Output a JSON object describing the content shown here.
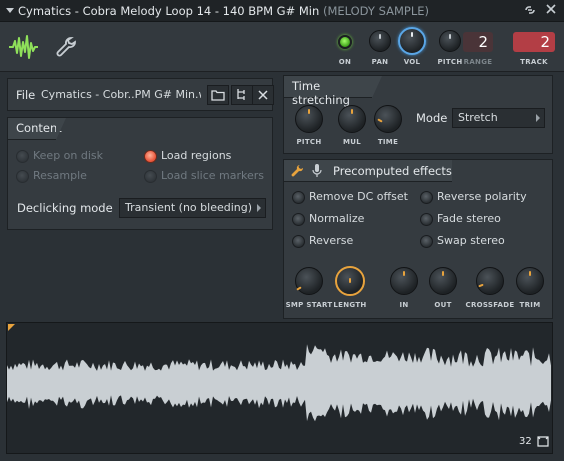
{
  "title": {
    "main": "Cymatics - Cobra Melody Loop 14 - 140 BPM G# Min",
    "sub": "(MELODY SAMPLE)"
  },
  "window": {
    "link_icon": "link-icon",
    "close_icon": "close-icon"
  },
  "toolbar": {
    "tabs": [
      {
        "icon": "waveform-icon",
        "active": true
      },
      {
        "icon": "wrench-icon",
        "active": false
      }
    ],
    "on_label": "ON",
    "pan_label": "PAN",
    "vol_label": "VOL",
    "pitch_label": "PITCH",
    "range_label": "RANGE",
    "range_value": "2",
    "track_label": "TRACK",
    "track_value": "2"
  },
  "file": {
    "label": "File",
    "name": "Cymatics - Cobr..PM G# Min.wav"
  },
  "content": {
    "header": "Content",
    "options": [
      {
        "label": "Keep on disk",
        "checked": false,
        "enabled": false
      },
      {
        "label": "Load regions",
        "checked": true,
        "enabled": true
      },
      {
        "label": "Resample",
        "checked": false,
        "enabled": false
      },
      {
        "label": "Load slice markers",
        "checked": false,
        "enabled": false
      }
    ],
    "declicking_label": "Declicking mode",
    "declicking_value": "Transient (no bleeding)"
  },
  "time_stretching": {
    "header": "Time stretching",
    "knobs": [
      "PITCH",
      "MUL",
      "TIME"
    ],
    "mode_label": "Mode",
    "mode_value": "Stretch"
  },
  "precomputed": {
    "header": "Precomputed effects",
    "effects": [
      {
        "label": "Remove DC offset",
        "checked": false
      },
      {
        "label": "Reverse polarity",
        "checked": false
      },
      {
        "label": "Normalize",
        "checked": false
      },
      {
        "label": "Fade stereo",
        "checked": false
      },
      {
        "label": "Reverse",
        "checked": false
      },
      {
        "label": "Swap stereo",
        "checked": false
      }
    ],
    "knobs": [
      "SMP START",
      "LENGTH",
      "IN",
      "OUT",
      "CROSSFADE",
      "TRIM"
    ]
  },
  "waveform": {
    "zoom_value": "32"
  },
  "colors": {
    "accent": "#e8a33d",
    "led": "#5fd22a",
    "radio_on": "#e8553a",
    "range_box": "#4a3438",
    "track_box": "#b33e45",
    "wave": "#c9cfd3"
  }
}
